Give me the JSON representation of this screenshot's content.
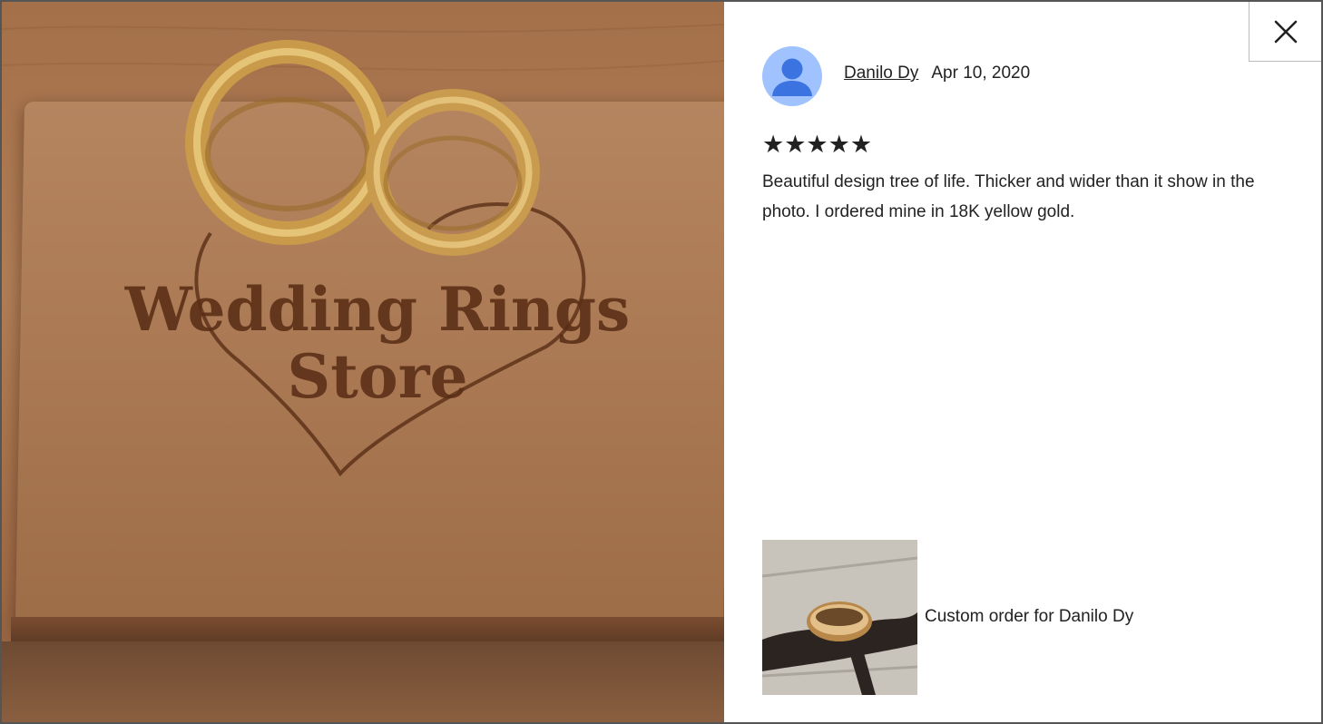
{
  "photo": {
    "engraving_line1": "Wedding Rings",
    "engraving_line2": "Store"
  },
  "review": {
    "author": "Danilo Dy",
    "date": "Apr 10, 2020",
    "rating": 5,
    "stars": "★★★★★",
    "text": "Beautiful design tree of life. Thicker and wider than it show in the photo. I ordered mine in 18K yellow gold.",
    "attachment_caption": "Custom order for Danilo Dy"
  },
  "colors": {
    "avatar_bg": "#a0c3ff",
    "avatar_fg": "#3b74e0",
    "wood": "#a97852",
    "engraving": "#5a2e16"
  },
  "icons": {
    "close": "close-icon",
    "avatar": "user-avatar-icon"
  }
}
